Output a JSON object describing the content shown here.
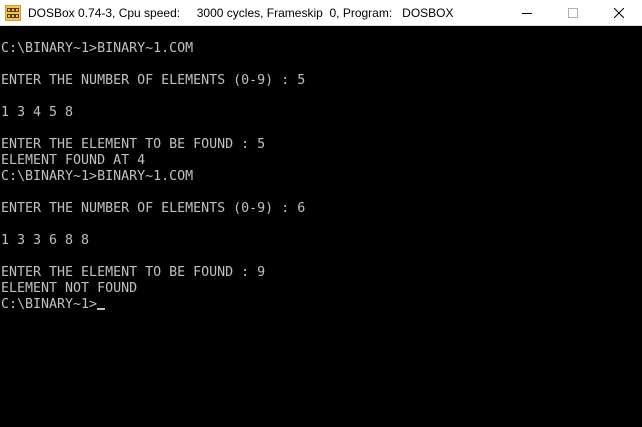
{
  "window": {
    "title": "DOSBox 0.74-3, Cpu speed:     3000 cycles, Frameskip  0, Program:   DOSBOX",
    "icon": "dosbox-icon",
    "buttons": [
      "minimize-icon",
      "maximize-icon",
      "close-icon"
    ]
  },
  "console": {
    "lines": [
      "C:\\BINARY~1>BINARY~1.COM",
      "",
      "ENTER THE NUMBER OF ELEMENTS (0-9) : 5",
      "",
      "1 3 4 5 8",
      "",
      "ENTER THE ELEMENT TO BE FOUND : 5",
      "ELEMENT FOUND AT 4",
      "C:\\BINARY~1>BINARY~1.COM",
      "",
      "ENTER THE NUMBER OF ELEMENTS (0-9) : 6",
      "",
      "1 3 3 6 8 8",
      "",
      "ENTER THE ELEMENT TO BE FOUND : 9",
      "ELEMENT NOT FOUND",
      "C:\\BINARY~1>"
    ],
    "text_color": "#c0c0c0",
    "background": "#000000"
  }
}
